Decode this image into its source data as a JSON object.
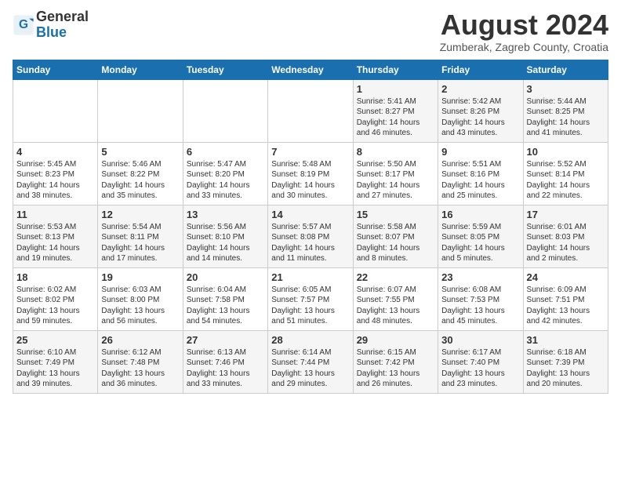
{
  "logo": {
    "general": "General",
    "blue": "Blue"
  },
  "title": "August 2024",
  "location": "Zumberak, Zagreb County, Croatia",
  "days_of_week": [
    "Sunday",
    "Monday",
    "Tuesday",
    "Wednesday",
    "Thursday",
    "Friday",
    "Saturday"
  ],
  "weeks": [
    [
      {
        "day": "",
        "info": ""
      },
      {
        "day": "",
        "info": ""
      },
      {
        "day": "",
        "info": ""
      },
      {
        "day": "",
        "info": ""
      },
      {
        "day": "1",
        "info": "Sunrise: 5:41 AM\nSunset: 8:27 PM\nDaylight: 14 hours\nand 46 minutes."
      },
      {
        "day": "2",
        "info": "Sunrise: 5:42 AM\nSunset: 8:26 PM\nDaylight: 14 hours\nand 43 minutes."
      },
      {
        "day": "3",
        "info": "Sunrise: 5:44 AM\nSunset: 8:25 PM\nDaylight: 14 hours\nand 41 minutes."
      }
    ],
    [
      {
        "day": "4",
        "info": "Sunrise: 5:45 AM\nSunset: 8:23 PM\nDaylight: 14 hours\nand 38 minutes."
      },
      {
        "day": "5",
        "info": "Sunrise: 5:46 AM\nSunset: 8:22 PM\nDaylight: 14 hours\nand 35 minutes."
      },
      {
        "day": "6",
        "info": "Sunrise: 5:47 AM\nSunset: 8:20 PM\nDaylight: 14 hours\nand 33 minutes."
      },
      {
        "day": "7",
        "info": "Sunrise: 5:48 AM\nSunset: 8:19 PM\nDaylight: 14 hours\nand 30 minutes."
      },
      {
        "day": "8",
        "info": "Sunrise: 5:50 AM\nSunset: 8:17 PM\nDaylight: 14 hours\nand 27 minutes."
      },
      {
        "day": "9",
        "info": "Sunrise: 5:51 AM\nSunset: 8:16 PM\nDaylight: 14 hours\nand 25 minutes."
      },
      {
        "day": "10",
        "info": "Sunrise: 5:52 AM\nSunset: 8:14 PM\nDaylight: 14 hours\nand 22 minutes."
      }
    ],
    [
      {
        "day": "11",
        "info": "Sunrise: 5:53 AM\nSunset: 8:13 PM\nDaylight: 14 hours\nand 19 minutes."
      },
      {
        "day": "12",
        "info": "Sunrise: 5:54 AM\nSunset: 8:11 PM\nDaylight: 14 hours\nand 17 minutes."
      },
      {
        "day": "13",
        "info": "Sunrise: 5:56 AM\nSunset: 8:10 PM\nDaylight: 14 hours\nand 14 minutes."
      },
      {
        "day": "14",
        "info": "Sunrise: 5:57 AM\nSunset: 8:08 PM\nDaylight: 14 hours\nand 11 minutes."
      },
      {
        "day": "15",
        "info": "Sunrise: 5:58 AM\nSunset: 8:07 PM\nDaylight: 14 hours\nand 8 minutes."
      },
      {
        "day": "16",
        "info": "Sunrise: 5:59 AM\nSunset: 8:05 PM\nDaylight: 14 hours\nand 5 minutes."
      },
      {
        "day": "17",
        "info": "Sunrise: 6:01 AM\nSunset: 8:03 PM\nDaylight: 14 hours\nand 2 minutes."
      }
    ],
    [
      {
        "day": "18",
        "info": "Sunrise: 6:02 AM\nSunset: 8:02 PM\nDaylight: 13 hours\nand 59 minutes."
      },
      {
        "day": "19",
        "info": "Sunrise: 6:03 AM\nSunset: 8:00 PM\nDaylight: 13 hours\nand 56 minutes."
      },
      {
        "day": "20",
        "info": "Sunrise: 6:04 AM\nSunset: 7:58 PM\nDaylight: 13 hours\nand 54 minutes."
      },
      {
        "day": "21",
        "info": "Sunrise: 6:05 AM\nSunset: 7:57 PM\nDaylight: 13 hours\nand 51 minutes."
      },
      {
        "day": "22",
        "info": "Sunrise: 6:07 AM\nSunset: 7:55 PM\nDaylight: 13 hours\nand 48 minutes."
      },
      {
        "day": "23",
        "info": "Sunrise: 6:08 AM\nSunset: 7:53 PM\nDaylight: 13 hours\nand 45 minutes."
      },
      {
        "day": "24",
        "info": "Sunrise: 6:09 AM\nSunset: 7:51 PM\nDaylight: 13 hours\nand 42 minutes."
      }
    ],
    [
      {
        "day": "25",
        "info": "Sunrise: 6:10 AM\nSunset: 7:49 PM\nDaylight: 13 hours\nand 39 minutes."
      },
      {
        "day": "26",
        "info": "Sunrise: 6:12 AM\nSunset: 7:48 PM\nDaylight: 13 hours\nand 36 minutes."
      },
      {
        "day": "27",
        "info": "Sunrise: 6:13 AM\nSunset: 7:46 PM\nDaylight: 13 hours\nand 33 minutes."
      },
      {
        "day": "28",
        "info": "Sunrise: 6:14 AM\nSunset: 7:44 PM\nDaylight: 13 hours\nand 29 minutes."
      },
      {
        "day": "29",
        "info": "Sunrise: 6:15 AM\nSunset: 7:42 PM\nDaylight: 13 hours\nand 26 minutes."
      },
      {
        "day": "30",
        "info": "Sunrise: 6:17 AM\nSunset: 7:40 PM\nDaylight: 13 hours\nand 23 minutes."
      },
      {
        "day": "31",
        "info": "Sunrise: 6:18 AM\nSunset: 7:39 PM\nDaylight: 13 hours\nand 20 minutes."
      }
    ]
  ]
}
